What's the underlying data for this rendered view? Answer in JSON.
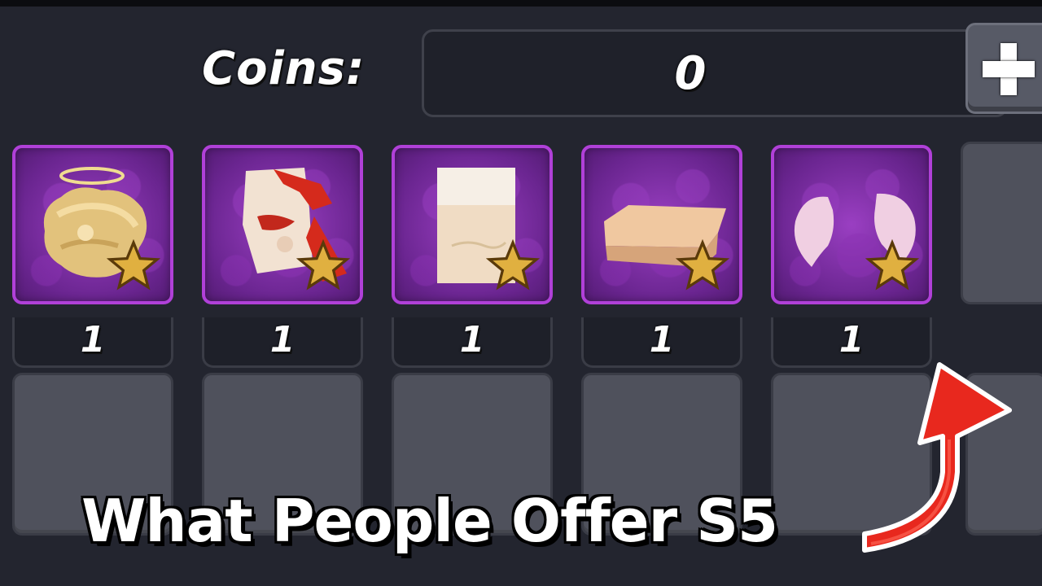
{
  "header": {
    "coins_label": "Coins:",
    "coins_value": "0",
    "add_icon": "plus-icon"
  },
  "inventory": {
    "items": [
      {
        "name": "halo-blonde-hair-icon",
        "count": "1",
        "rarity_icon": "star-icon"
      },
      {
        "name": "red-scarf-mask-icon",
        "count": "1",
        "rarity_icon": "star-icon"
      },
      {
        "name": "paper-scroll-icon",
        "count": "1",
        "rarity_icon": "star-icon"
      },
      {
        "name": "beige-block-icon",
        "count": "1",
        "rarity_icon": "star-icon"
      },
      {
        "name": "pink-wings-icon",
        "count": "1",
        "rarity_icon": "star-icon"
      }
    ]
  },
  "caption": "What People Offer S5",
  "colors": {
    "background": "#23252f",
    "slot_border": "#b040d8",
    "slot_fill": "#7a2ca6",
    "empty_slot": "#4f515c",
    "arrow": "#e8281e",
    "star": "#e0b040"
  }
}
